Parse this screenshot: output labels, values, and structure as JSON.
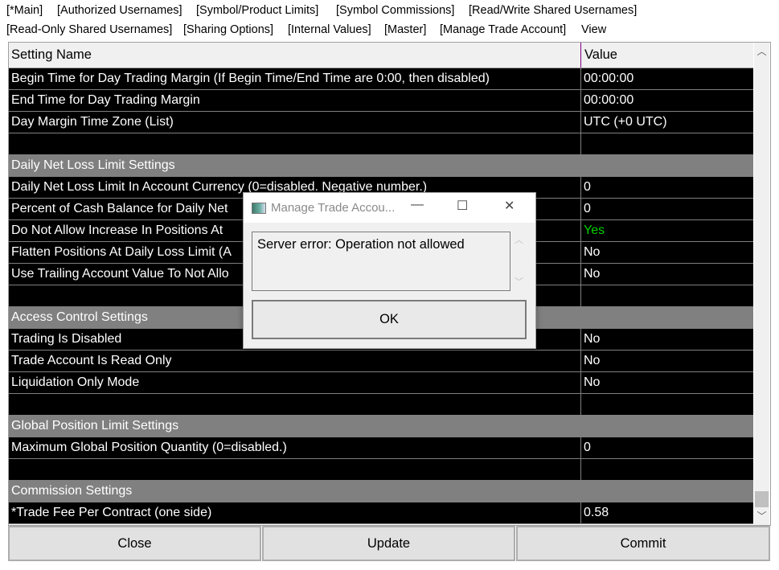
{
  "menu": {
    "row1": [
      "[*Main]",
      "[Authorized Usernames]",
      "[Symbol/Product Limits]",
      "[Symbol Commissions]",
      "[Read/Write Shared Usernames]"
    ],
    "row2": [
      "[Read-Only Shared Usernames]",
      "[Sharing Options]",
      "[Internal Values]",
      "[Master]",
      "[Manage Trade Account]",
      "View"
    ]
  },
  "table": {
    "col_name": "Setting Name",
    "col_value": "Value",
    "rows": [
      {
        "name": "Begin Time for Day Trading Margin (If Begin Time/End Time are 0:00, then disabled)",
        "value": "00:00:00"
      },
      {
        "name": "End Time for Day Trading Margin",
        "value": "00:00:00"
      },
      {
        "name": "Day Margin Time Zone (List)",
        "value": "UTC (+0 UTC)"
      },
      {
        "name": "",
        "value": ""
      },
      {
        "name": "Daily Net Loss Limit Settings",
        "value": "",
        "group": true
      },
      {
        "name": "Daily Net Loss Limit In Account Currency (0=disabled. Negative number.)",
        "value": "0"
      },
      {
        "name": "Percent of Cash Balance for Daily Net",
        "value": "0"
      },
      {
        "name": "Do Not Allow Increase In Positions At",
        "value": "Yes",
        "green": true
      },
      {
        "name": "Flatten Positions At Daily Loss Limit (A",
        "value": "No"
      },
      {
        "name": "Use Trailing Account Value To Not Allo",
        "value": "No"
      },
      {
        "name": "",
        "value": ""
      },
      {
        "name": "Access Control Settings",
        "value": "",
        "group": true
      },
      {
        "name": "Trading Is Disabled",
        "value": "No"
      },
      {
        "name": "Trade Account Is Read Only",
        "value": "No"
      },
      {
        "name": "Liquidation Only Mode",
        "value": "No"
      },
      {
        "name": "",
        "value": ""
      },
      {
        "name": "Global Position Limit Settings",
        "value": "",
        "group": true
      },
      {
        "name": "Maximum Global Position Quantity (0=disabled.)",
        "value": "0"
      },
      {
        "name": "",
        "value": ""
      },
      {
        "name": "Commission Settings",
        "value": "",
        "group": true
      },
      {
        "name": "*Trade Fee Per Contract (one side)",
        "value": "0.58"
      }
    ]
  },
  "buttons": {
    "close": "Close",
    "update": "Update",
    "commit": "Commit"
  },
  "dialog": {
    "title": "Manage Trade Accou...",
    "message": "Server error: Operation not allowed",
    "ok": "OK",
    "minimize": "—",
    "maximize": "☐",
    "close": "✕"
  }
}
